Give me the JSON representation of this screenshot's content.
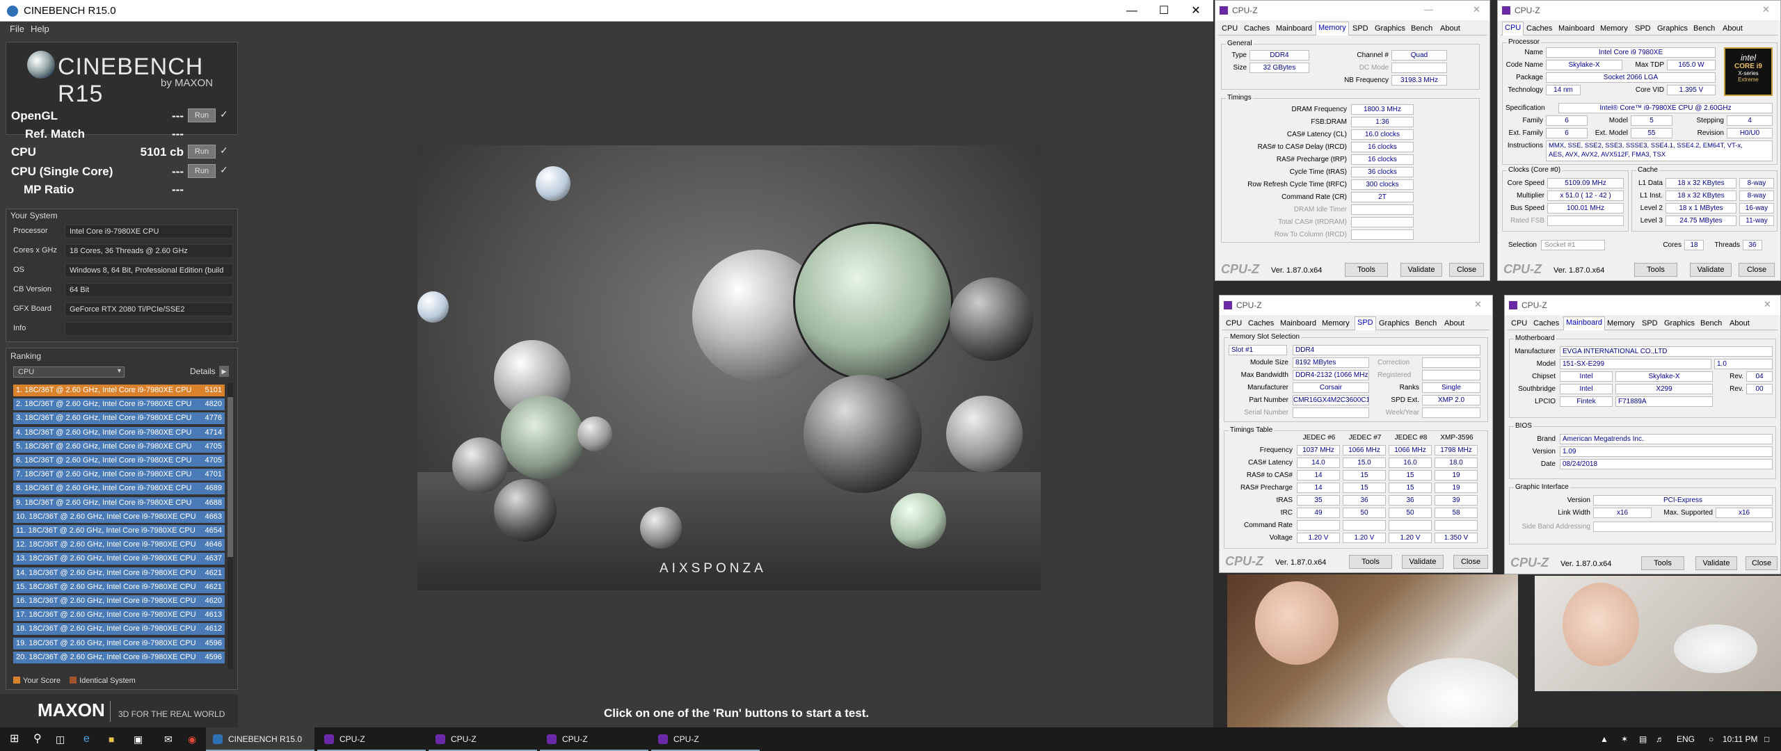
{
  "cinebench": {
    "title": "CINEBENCH R15.0",
    "menu": [
      "File",
      "Help"
    ],
    "logo": {
      "main": "CINEBENCH R15",
      "sub": "by MAXON"
    },
    "scores": [
      {
        "label": "OpenGL",
        "value": "---",
        "run": "Run",
        "check": "✓"
      },
      {
        "label": "Ref. Match",
        "value": "---"
      },
      {
        "label": "CPU",
        "value": "5101 cb",
        "run": "Run",
        "check": "✓"
      },
      {
        "label": "CPU (Single Core)",
        "value": "---",
        "run": "Run",
        "check": "✓"
      },
      {
        "label": "MP Ratio",
        "value": "---"
      }
    ],
    "system": {
      "title": "Your System",
      "rows": [
        {
          "k": "Processor",
          "v": "Intel Core i9-7980XE CPU"
        },
        {
          "k": "Cores x GHz",
          "v": "18 Cores, 36 Threads @ 2.60 GHz"
        },
        {
          "k": "OS",
          "v": "Windows 8, 64 Bit, Professional Edition (build"
        },
        {
          "k": "CB Version",
          "v": "64 Bit"
        },
        {
          "k": "GFX Board",
          "v": "GeForce RTX 2080 Ti/PCIe/SSE2"
        },
        {
          "k": "Info",
          "v": ""
        }
      ]
    },
    "ranking": {
      "title": "Ranking",
      "select": "CPU",
      "details": "Details",
      "rows": [
        {
          "n": "1. 18C/36T @ 2.60 GHz, Intel Core i9-7980XE CPU",
          "s": "5101",
          "mine": true
        },
        {
          "n": "2. 18C/36T @ 2.60 GHz, Intel Core i9-7980XE CPU",
          "s": "4820"
        },
        {
          "n": "3. 18C/36T @ 2.60 GHz, Intel Core i9-7980XE CPU",
          "s": "4776"
        },
        {
          "n": "4. 18C/36T @ 2.60 GHz, Intel Core i9-7980XE CPU",
          "s": "4714"
        },
        {
          "n": "5. 18C/36T @ 2.60 GHz, Intel Core i9-7980XE CPU",
          "s": "4705"
        },
        {
          "n": "6. 18C/36T @ 2.60 GHz, Intel Core i9-7980XE CPU",
          "s": "4705"
        },
        {
          "n": "7. 18C/36T @ 2.60 GHz, Intel Core i9-7980XE CPU",
          "s": "4701"
        },
        {
          "n": "8. 18C/36T @ 2.60 GHz, Intel Core i9-7980XE CPU",
          "s": "4689"
        },
        {
          "n": "9. 18C/36T @ 2.60 GHz, Intel Core i9-7980XE CPU",
          "s": "4688"
        },
        {
          "n": "10. 18C/36T @ 2.60 GHz, Intel Core i9-7980XE CPU",
          "s": "4663"
        },
        {
          "n": "11. 18C/36T @ 2.60 GHz, Intel Core i9-7980XE CPU",
          "s": "4654"
        },
        {
          "n": "12. 18C/36T @ 2.60 GHz, Intel Core i9-7980XE CPU",
          "s": "4646"
        },
        {
          "n": "13. 18C/36T @ 2.60 GHz, Intel Core i9-7980XE CPU",
          "s": "4637"
        },
        {
          "n": "14. 18C/36T @ 2.60 GHz, Intel Core i9-7980XE CPU",
          "s": "4621"
        },
        {
          "n": "15. 18C/36T @ 2.60 GHz, Intel Core i9-7980XE CPU",
          "s": "4621"
        },
        {
          "n": "16. 18C/36T @ 2.60 GHz, Intel Core i9-7980XE CPU",
          "s": "4620"
        },
        {
          "n": "17. 18C/36T @ 2.60 GHz, Intel Core i9-7980XE CPU",
          "s": "4613"
        },
        {
          "n": "18. 18C/36T @ 2.60 GHz, Intel Core i9-7980XE CPU",
          "s": "4612"
        },
        {
          "n": "19. 18C/36T @ 2.60 GHz, Intel Core i9-7980XE CPU",
          "s": "4596"
        },
        {
          "n": "20. 18C/36T @ 2.60 GHz, Intel Core i9-7980XE CPU",
          "s": "4596"
        }
      ],
      "legend_your": "Your Score",
      "legend_ident": "Identical System"
    },
    "render_brand": "AIXSPONZA",
    "maxon": {
      "logo": "MAXON",
      "tag": "3D FOR THE REAL WORLD"
    },
    "status": "Click on one of the 'Run' buttons to start a test.",
    "colors": {
      "mine": "#d9822b",
      "other": "#4a7bb7"
    }
  },
  "cpuz_common": {
    "title": "CPU-Z",
    "logo": "CPU-Z",
    "version": "Ver. 1.87.0.x64",
    "tools": "Tools",
    "validate": "Validate",
    "close": "Close",
    "tabs": [
      "CPU",
      "Caches",
      "Mainboard",
      "Memory",
      "SPD",
      "Graphics",
      "Bench",
      "About"
    ]
  },
  "cpuz_memory": {
    "general_title": "General",
    "type_k": "Type",
    "type": "DDR4",
    "size_k": "Size",
    "size": "32 GBytes",
    "channel_k": "Channel #",
    "channel": "Quad",
    "dc_k": "DC Mode",
    "nb_k": "NB Frequency",
    "nb": "3198.3 MHz",
    "timings_title": "Timings",
    "timings": [
      {
        "k": "DRAM Frequency",
        "v": "1800.3 MHz"
      },
      {
        "k": "FSB:DRAM",
        "v": "1:36"
      },
      {
        "k": "CAS# Latency (CL)",
        "v": "16.0 clocks"
      },
      {
        "k": "RAS# to CAS# Delay (tRCD)",
        "v": "16 clocks"
      },
      {
        "k": "RAS# Precharge (tRP)",
        "v": "16 clocks"
      },
      {
        "k": "Cycle Time (tRAS)",
        "v": "36 clocks"
      },
      {
        "k": "Row Refresh Cycle Time (tRFC)",
        "v": "300 clocks"
      },
      {
        "k": "Command Rate (CR)",
        "v": "2T"
      },
      {
        "k": "DRAM Idle Timer",
        "v": "",
        "dim": true
      },
      {
        "k": "Total CAS# (tRDRAM)",
        "v": "",
        "dim": true
      },
      {
        "k": "Row To Column (tRCD)",
        "v": "",
        "dim": true
      }
    ]
  },
  "cpuz_cpu": {
    "proc_title": "Processor",
    "name_k": "Name",
    "name": "Intel Core i9 7980XE",
    "code_k": "Code Name",
    "code": "Skylake-X",
    "tdp_k": "Max TDP",
    "tdp": "165.0 W",
    "pkg_k": "Package",
    "pkg": "Socket 2066 LGA",
    "tech_k": "Technology",
    "tech": "14 nm",
    "vid_k": "Core VID",
    "vid": "1.395 V",
    "spec_k": "Specification",
    "spec": "Intel® Core™ i9-7980XE CPU @ 2.60GHz",
    "fam_k": "Family",
    "fam": "6",
    "model_k": "Model",
    "model": "5",
    "step_k": "Stepping",
    "step": "4",
    "efam_k": "Ext. Family",
    "efam": "6",
    "emodel_k": "Ext. Model",
    "emodel": "55",
    "rev_k": "Revision",
    "rev": "H0/U0",
    "instr_k": "Instructions",
    "instr1": "MMX, SSE, SSE2, SSE3, SSSE3, SSE4.1, SSE4.2, EM64T, VT-x,",
    "instr2": "AES, AVX, AVX2, AVX512F, FMA3, TSX",
    "clocks_title": "Clocks (Core #0)",
    "cache_title": "Cache",
    "speed_k": "Core Speed",
    "speed": "5109.09 MHz",
    "mult_k": "Multiplier",
    "mult": "x 51.0 ( 12 - 42 )",
    "bus_k": "Bus Speed",
    "bus": "100.01 MHz",
    "fsb_k": "Rated FSB",
    "l1d_k": "L1 Data",
    "l1d": "18 x 32 KBytes",
    "l1d_w": "8-way",
    "l1i_k": "L1 Inst.",
    "l1i": "18 x 32 KBytes",
    "l1i_w": "8-way",
    "l2_k": "Level 2",
    "l2": "18 x 1 MBytes",
    "l2_w": "16-way",
    "l3_k": "Level 3",
    "l3": "24.75 MBytes",
    "l3_w": "11-way",
    "sel_k": "Selection",
    "sel": "Socket #1",
    "cores_k": "Cores",
    "cores": "18",
    "threads_k": "Threads",
    "threads": "36",
    "badge1": "intel",
    "badge2": "CORE i9",
    "badge3": "X-series",
    "badge4": "Extreme"
  },
  "cpuz_spd": {
    "slot_title": "Memory Slot Selection",
    "slot": "Slot #1",
    "type": "DDR4",
    "modsize_k": "Module Size",
    "modsize": "8192 MBytes",
    "corr_k": "Correction",
    "bw_k": "Max Bandwidth",
    "bw": "DDR4-2132 (1066 MHz)",
    "reg_k": "Registered",
    "mfr_k": "Manufacturer",
    "mfr": "Corsair",
    "ranks_k": "Ranks",
    "ranks": "Single",
    "pn_k": "Part Number",
    "pn": "CMR16GX4M2C3600C18",
    "spdext_k": "SPD Ext.",
    "spdext": "XMP 2.0",
    "sn_k": "Serial Number",
    "week_k": "Week/Year",
    "tt_title": "Timings Table",
    "cols": [
      "JEDEC #6",
      "JEDEC #7",
      "JEDEC #8",
      "XMP-3596"
    ],
    "rows": [
      {
        "k": "Frequency",
        "v": [
          "1037 MHz",
          "1066 MHz",
          "1066 MHz",
          "1798 MHz"
        ]
      },
      {
        "k": "CAS# Latency",
        "v": [
          "14.0",
          "15.0",
          "16.0",
          "18.0"
        ]
      },
      {
        "k": "RAS# to CAS#",
        "v": [
          "14",
          "15",
          "15",
          "19"
        ]
      },
      {
        "k": "RAS# Precharge",
        "v": [
          "14",
          "15",
          "15",
          "19"
        ]
      },
      {
        "k": "tRAS",
        "v": [
          "35",
          "36",
          "36",
          "39"
        ]
      },
      {
        "k": "tRC",
        "v": [
          "49",
          "50",
          "50",
          "58"
        ]
      },
      {
        "k": "Command Rate",
        "v": [
          "",
          "",
          "",
          ""
        ]
      },
      {
        "k": "Voltage",
        "v": [
          "1.20 V",
          "1.20 V",
          "1.20 V",
          "1.350 V"
        ]
      }
    ]
  },
  "cpuz_mb": {
    "mb_title": "Motherboard",
    "mfr_k": "Manufacturer",
    "mfr": "EVGA INTERNATIONAL CO.,LTD",
    "model_k": "Model",
    "model": "151-SX-E299",
    "model_rev": "1.0",
    "chip_k": "Chipset",
    "chip1": "Intel",
    "chip2": "Skylake-X",
    "rev_k": "Rev.",
    "chip_rev": "04",
    "sb_k": "Southbridge",
    "sb1": "Intel",
    "sb2": "X299",
    "sb_rev": "00",
    "lpc_k": "LPCIO",
    "lpc1": "Fintek",
    "lpc2": "F71889A",
    "bios_title": "BIOS",
    "brand_k": "Brand",
    "brand": "American Megatrends Inc.",
    "ver_k": "Version",
    "ver": "1.09",
    "date_k": "Date",
    "date": "08/24/2018",
    "gi_title": "Graphic Interface",
    "giv_k": "Version",
    "giv": "PCI-Express",
    "lw_k": "Link Width",
    "lw": "x16",
    "ms_k": "Max. Supported",
    "ms": "x16",
    "sba_k": "Side Band Addressing"
  },
  "taskbar": {
    "apps": [
      {
        "label": "CINEBENCH R15.0",
        "color": "#2f6fb4"
      },
      {
        "label": "CPU-Z",
        "color": "#6a2aa8"
      },
      {
        "label": "CPU-Z",
        "color": "#6a2aa8"
      },
      {
        "label": "CPU-Z",
        "color": "#6a2aa8"
      },
      {
        "label": "CPU-Z",
        "color": "#6a2aa8"
      }
    ],
    "lang": "ENG",
    "time": "10:11 PM"
  }
}
